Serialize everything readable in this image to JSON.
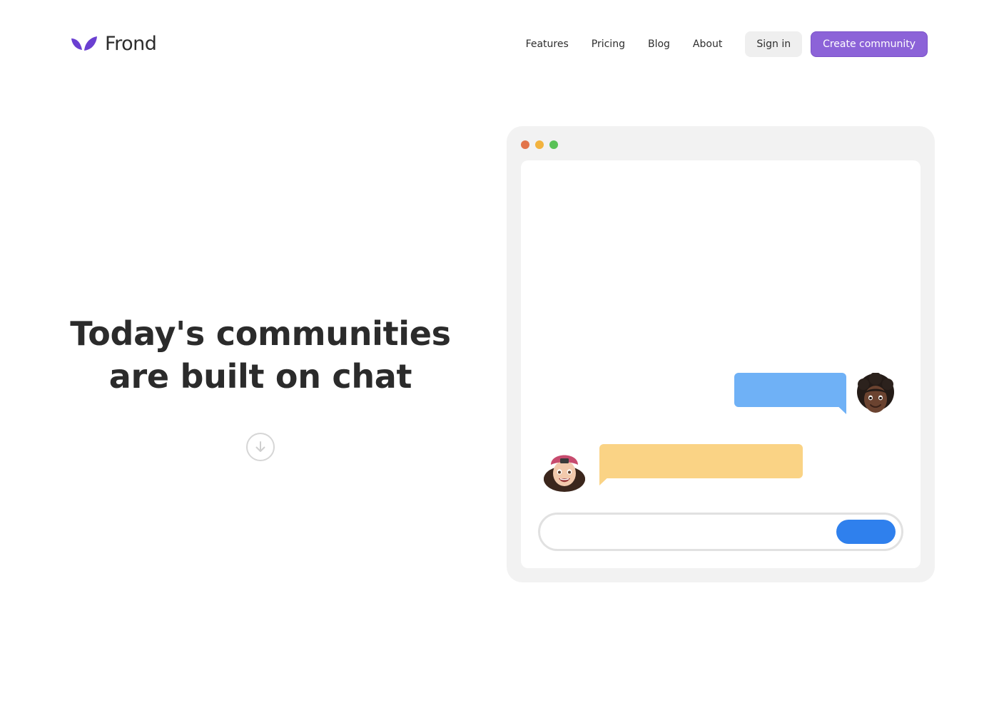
{
  "brand": {
    "name": "Frond",
    "accent_color": "#8c63d8",
    "logo_color": "#6a3fd1"
  },
  "nav": {
    "links": [
      "Features",
      "Pricing",
      "Blog",
      "About"
    ],
    "sign_in_label": "Sign in",
    "create_label": "Create community"
  },
  "hero": {
    "title_line1": "Today's communities",
    "title_line2": "are built on chat",
    "scroll_icon": "arrow-down-circle-icon"
  },
  "illustration": {
    "window_dots": [
      "#e2744b",
      "#f2b33f",
      "#5ac258"
    ],
    "outgoing_bubble_color": "#6fb1f6",
    "incoming_bubble_color": "#fad385",
    "send_button_color": "#2f80ed",
    "avatar_right": "memoji-curly-hair-avatar",
    "avatar_left": "memoji-cap-avatar"
  }
}
